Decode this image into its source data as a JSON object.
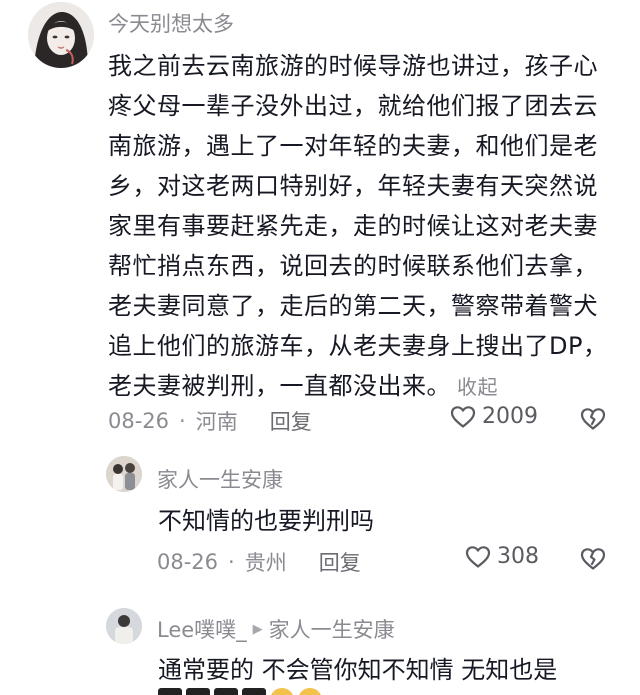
{
  "main_comment": {
    "username": "今天别想太多",
    "text": "我之前去云南旅游的时候导游也讲过，孩子心疼父母一辈子没外出过，就给他们报了团去云南旅游，遇上了一对年轻的夫妻，和他们是老乡，对这老两口特别好，年轻夫妻有天突然说家里有事要赶紧先走，走的时候让这对老夫妻帮忙捎点东西，说回去的时候联系他们去拿，老夫妻同意了，走后的第二天，警察带着警犬追上他们的旅游车，从老夫妻身上搜出了DP，老夫妻被判刑，一直都没出来。",
    "collapse_label": "收起",
    "date": "08-26",
    "separator": "·",
    "location": "河南",
    "reply_label": "回复",
    "like_count": "2009"
  },
  "replies": [
    {
      "username": "家人一生安康",
      "text": "不知情的也要判刑吗",
      "date": "08-26",
      "separator": "·",
      "location": "贵州",
      "reply_label": "回复",
      "like_count": "308"
    },
    {
      "username": "Lee噗噗_",
      "reply_to_arrow": "▶",
      "reply_to": "家人一生安康",
      "text": "通常要的 不会管你知不知情 无知也是"
    }
  ],
  "colors": {
    "text_primary": "#161823",
    "text_secondary": "#8a8b91",
    "emoji_yellow": "#f2c24a"
  },
  "icons": {
    "like": "heart-outline-icon",
    "dislike": "broken-heart-icon"
  }
}
